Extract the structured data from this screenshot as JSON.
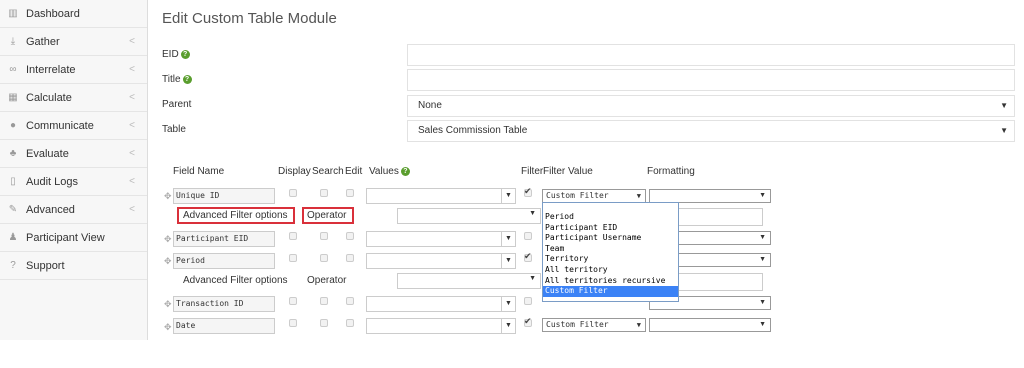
{
  "sidebar": {
    "items": [
      {
        "label": "Dashboard",
        "icon": "bar-chart-icon",
        "glyph": "▥",
        "chevron": false
      },
      {
        "label": "Gather",
        "icon": "download-icon",
        "glyph": "⤓",
        "chevron": true
      },
      {
        "label": "Interrelate",
        "icon": "link-icon",
        "glyph": "∞",
        "chevron": true
      },
      {
        "label": "Calculate",
        "icon": "table-icon",
        "glyph": "▦",
        "chevron": true
      },
      {
        "label": "Communicate",
        "icon": "comments-icon",
        "glyph": "●",
        "chevron": true
      },
      {
        "label": "Evaluate",
        "icon": "thumbs-up-icon",
        "glyph": "♣",
        "chevron": true
      },
      {
        "label": "Audit Logs",
        "icon": "file-icon",
        "glyph": "▯",
        "chevron": true
      },
      {
        "label": "Advanced",
        "icon": "wrench-icon",
        "glyph": "✎",
        "chevron": true
      },
      {
        "label": "Participant View",
        "icon": "user-icon",
        "glyph": "♟",
        "chevron": false
      },
      {
        "label": "Support",
        "icon": "help-circle-icon",
        "glyph": "?",
        "chevron": false
      }
    ],
    "chevron_glyph": "<"
  },
  "page": {
    "title": "Edit Custom Table Module"
  },
  "form": {
    "eid_label": "EID",
    "title_label": "Title",
    "parent_label": "Parent",
    "parent_value": "None",
    "table_label": "Table",
    "table_value": "Sales Commission Table",
    "help_glyph": "?"
  },
  "columns": {
    "field_name": "Field Name",
    "display": "Display",
    "search": "Search",
    "edit": "Edit",
    "values": "Values",
    "filter": "Filter",
    "filter_value": "Filter Value",
    "formatting": "Formatting"
  },
  "rows": [
    {
      "name": "Unique ID",
      "filter_checked": true,
      "filter_value": "Custom Filter"
    },
    {
      "name": "Participant EID",
      "filter_checked": false,
      "filter_value": ""
    },
    {
      "name": "Period",
      "filter_checked": true,
      "filter_value": ""
    },
    {
      "name": "Transaction ID",
      "filter_checked": false,
      "filter_value": ""
    },
    {
      "name": "Date",
      "filter_checked": true,
      "filter_value": "Custom Filter"
    }
  ],
  "advanced": {
    "filter_options_label": "Advanced Filter options",
    "operator_label": "Operator"
  },
  "dropdown": {
    "options": [
      "",
      "Period",
      "Participant EID",
      "Participant Username",
      "Team",
      "Territory",
      "All territory",
      "All territories recursive",
      "Custom Filter"
    ],
    "selected": "Custom Filter"
  },
  "colors": {
    "accent": "#3b82f6",
    "highlight_border": "#d9303a",
    "help_green": "#5a9e2e"
  }
}
